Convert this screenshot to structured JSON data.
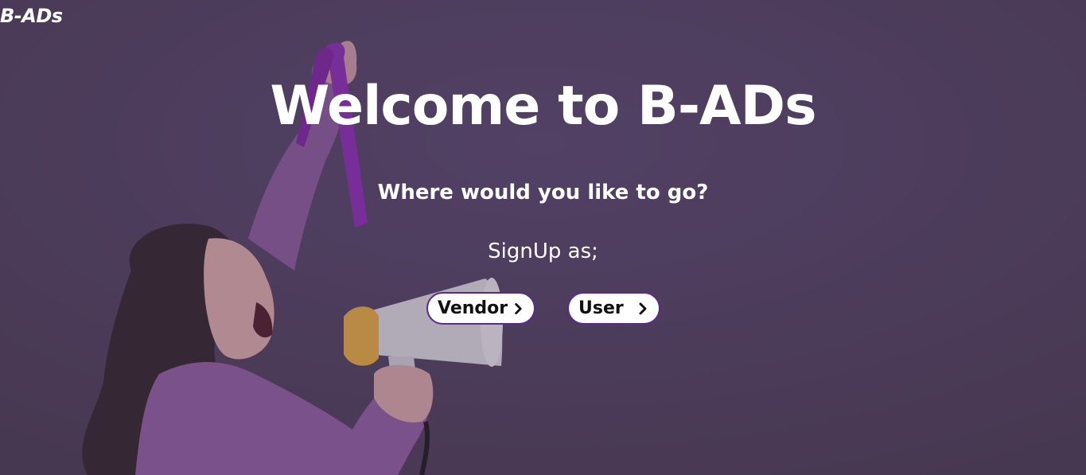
{
  "brand": {
    "logo_text": "B-ADs"
  },
  "hero": {
    "title": "Welcome to B-ADs",
    "subtitle": "Where would you like to go?",
    "signup_label": "SignUp as;"
  },
  "actions": {
    "vendor_label": "Vendor",
    "user_label": "User",
    "chevron_icon": "chevron-right-icon"
  },
  "colors": {
    "background": "#4b3c58",
    "button_border": "#5a2a8c",
    "text": "#ffffff"
  }
}
